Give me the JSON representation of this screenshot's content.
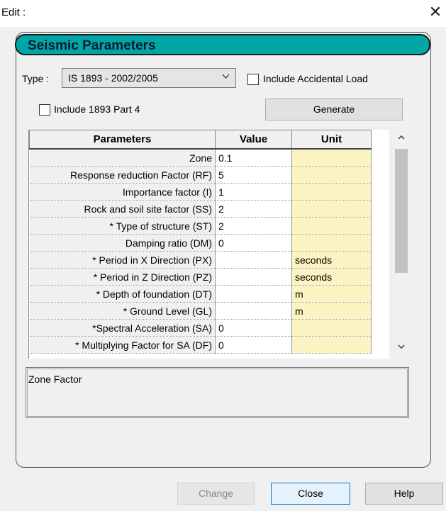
{
  "window": {
    "title": "Edit :",
    "close_glyph": "✕"
  },
  "header": {
    "title": "Seismic Parameters"
  },
  "type_field": {
    "label": "Type :",
    "value": "IS 1893 - 2002/2005",
    "dropdown_icon": "chevron-down-icon"
  },
  "options": {
    "include_accidental_load": {
      "label": "Include Accidental Load",
      "checked": false
    },
    "include_1893_part4": {
      "label": "Include 1893 Part 4",
      "checked": false
    }
  },
  "generate_button": {
    "label": "Generate"
  },
  "table": {
    "columns": [
      "Parameters",
      "Value",
      "Unit"
    ],
    "rows": [
      {
        "param": "Zone",
        "value": "0.1",
        "unit": ""
      },
      {
        "param": "Response reduction Factor (RF)",
        "value": "5",
        "unit": ""
      },
      {
        "param": "Importance factor (I)",
        "value": "1",
        "unit": ""
      },
      {
        "param": "Rock and soil site factor (SS)",
        "value": "2",
        "unit": ""
      },
      {
        "param": "* Type of structure (ST)",
        "value": "2",
        "unit": ""
      },
      {
        "param": "Damping ratio (DM)",
        "value": "0",
        "unit": ""
      },
      {
        "param": "* Period in X Direction (PX)",
        "value": "",
        "unit": "seconds"
      },
      {
        "param": "* Period in Z Direction (PZ)",
        "value": "",
        "unit": "seconds"
      },
      {
        "param": "* Depth of foundation (DT)",
        "value": "",
        "unit": "m"
      },
      {
        "param": "* Ground Level (GL)",
        "value": "",
        "unit": "m"
      },
      {
        "param": "*Spectral Acceleration (SA)",
        "value": "0",
        "unit": ""
      },
      {
        "param": "* Multiplying Factor for SA (DF)",
        "value": "0",
        "unit": ""
      }
    ]
  },
  "description": {
    "text": "Zone Factor"
  },
  "buttons": {
    "change": "Change",
    "close": "Close",
    "help": "Help"
  }
}
